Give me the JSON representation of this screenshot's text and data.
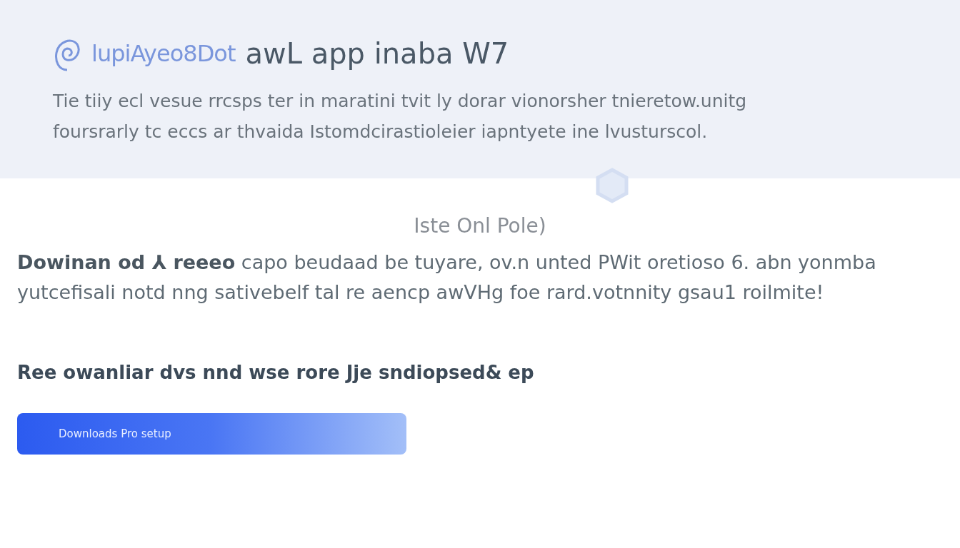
{
  "header": {
    "brand": "lupiAyeo8Dot",
    "title": "awL app inaba W7",
    "description": "Tie tiiy ecl vesue rrcsps ter in maratini tvit ly dorar vionorsher tnieretow.unitg foursrarly tc eccs ar thvaida Istomdcirastioleier iapntyete ine lvusturscol."
  },
  "section": {
    "subtitle": "Iste Onl Pole)",
    "paragraph": "**Dowinan od ⅄ reeeo** capo beudaad be tuyare, ov.n unted PWit oretioso   6. abn yonmba yutcefisali notd nng sativebelf tal re aencp awVHg foe rard.votnnity gsau1 roilmite!",
    "heading": "Ree owanliar dvs nnd wse rore Jje sndiopsed& ep",
    "button": "Downloads Pro setup"
  }
}
